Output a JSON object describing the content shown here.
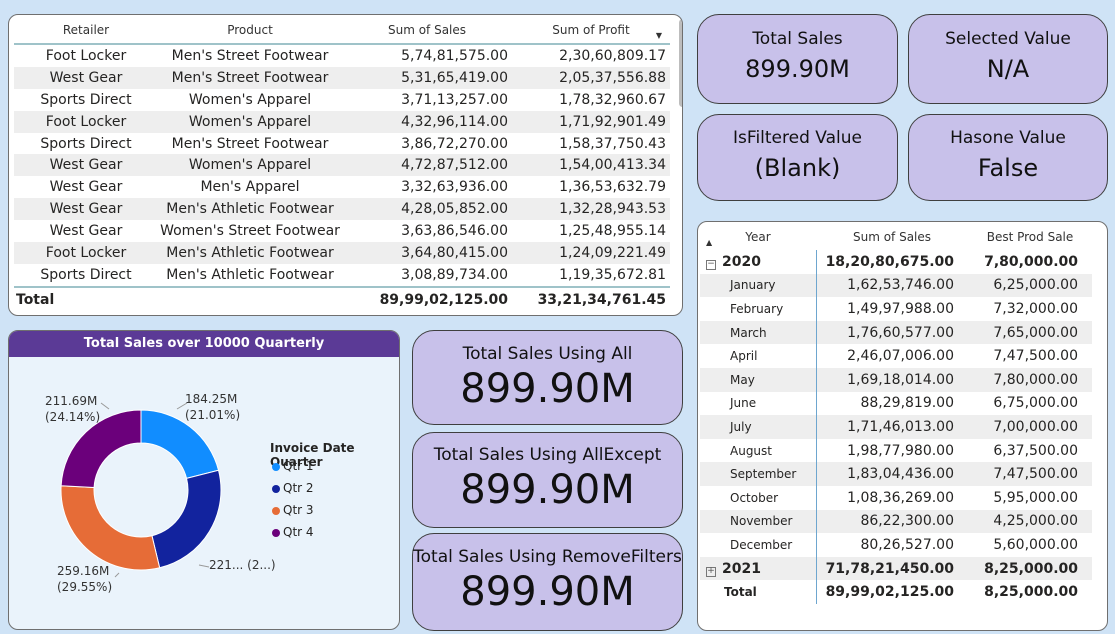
{
  "retail_table": {
    "columns": [
      "Retailer",
      "Product",
      "Sum of Sales",
      "Sum of Profit"
    ],
    "rows": [
      [
        "Foot Locker",
        "Men's Street Footwear",
        "5,74,81,575.00",
        "2,30,60,809.17"
      ],
      [
        "West Gear",
        "Men's Street Footwear",
        "5,31,65,419.00",
        "2,05,37,556.88"
      ],
      [
        "Sports Direct",
        "Women's Apparel",
        "3,71,13,257.00",
        "1,78,32,960.67"
      ],
      [
        "Foot Locker",
        "Women's Apparel",
        "4,32,96,114.00",
        "1,71,92,901.49"
      ],
      [
        "Sports Direct",
        "Men's Street Footwear",
        "3,86,72,270.00",
        "1,58,37,750.43"
      ],
      [
        "West Gear",
        "Women's Apparel",
        "4,72,87,512.00",
        "1,54,00,413.34"
      ],
      [
        "West Gear",
        "Men's Apparel",
        "3,32,63,936.00",
        "1,36,53,632.79"
      ],
      [
        "West Gear",
        "Men's Athletic Footwear",
        "4,28,05,852.00",
        "1,32,28,943.53"
      ],
      [
        "West Gear",
        "Women's Street Footwear",
        "3,63,86,546.00",
        "1,25,48,955.14"
      ],
      [
        "Foot Locker",
        "Men's Athletic Footwear",
        "3,64,80,415.00",
        "1,24,09,221.49"
      ],
      [
        "Sports Direct",
        "Men's Athletic Footwear",
        "3,08,89,734.00",
        "1,19,35,672.81"
      ]
    ],
    "total_label": "Total",
    "total_sales": "89,99,02,125.00",
    "total_profit": "33,21,34,761.45"
  },
  "cards": {
    "total_sales": {
      "title": "Total Sales",
      "value": "899.90M"
    },
    "selected_value": {
      "title": "Selected Value",
      "value": "N/A"
    },
    "isfiltered_value": {
      "title": "IsFiltered Value",
      "value": "(Blank)"
    },
    "hasone_value": {
      "title": "Hasone Value",
      "value": "False"
    },
    "using_all": {
      "title": "Total Sales Using All",
      "value": "899.90M"
    },
    "using_allexcept": {
      "title": "Total Sales Using AllExcept",
      "value": "899.90M"
    },
    "using_removefilters": {
      "title": "Total Sales Using RemoveFilters",
      "value": "899.90M"
    }
  },
  "chart_data": {
    "type": "pie",
    "title": "Total Sales over 10000 Quarterly",
    "legend_title": "Invoice Date Quarter",
    "legend_position": "right",
    "categories": [
      "Qtr 1",
      "Qtr 2",
      "Qtr 3",
      "Qtr 4"
    ],
    "values": [
      184.25,
      221.0,
      259.16,
      211.69
    ],
    "percents": [
      21.01,
      25.3,
      29.55,
      24.14
    ],
    "colors": [
      "#118DFF",
      "#12239E",
      "#E66C37",
      "#6B007B"
    ],
    "labels": {
      "qtr1": [
        "184.25M",
        "(21.01%)"
      ],
      "qtr2": [
        "221... (2...)"
      ],
      "qtr3": [
        "259.16M",
        "(29.55%)"
      ],
      "qtr4": [
        "211.69M",
        "(24.14%)"
      ]
    }
  },
  "year_table": {
    "columns": [
      "Year",
      "Sum of Sales",
      "Best Prod Sale"
    ],
    "year_2020": {
      "label": "2020",
      "sales": "18,20,80,675.00",
      "best": "7,80,000.00"
    },
    "months": [
      [
        "January",
        "1,62,53,746.00",
        "6,25,000.00"
      ],
      [
        "February",
        "1,49,97,988.00",
        "7,32,000.00"
      ],
      [
        "March",
        "1,76,60,577.00",
        "7,65,000.00"
      ],
      [
        "April",
        "2,46,07,006.00",
        "7,47,500.00"
      ],
      [
        "May",
        "1,69,18,014.00",
        "7,80,000.00"
      ],
      [
        "June",
        "88,29,819.00",
        "6,75,000.00"
      ],
      [
        "July",
        "1,71,46,013.00",
        "7,00,000.00"
      ],
      [
        "August",
        "1,98,77,980.00",
        "6,37,500.00"
      ],
      [
        "September",
        "1,83,04,436.00",
        "7,47,500.00"
      ],
      [
        "October",
        "1,08,36,269.00",
        "5,95,000.00"
      ],
      [
        "November",
        "86,22,300.00",
        "4,25,000.00"
      ],
      [
        "December",
        "80,26,527.00",
        "5,60,000.00"
      ]
    ],
    "year_2021": {
      "label": "2021",
      "sales": "71,78,21,450.00",
      "best": "8,25,000.00"
    },
    "total": {
      "label": "Total",
      "sales": "89,99,02,125.00",
      "best": "8,25,000.00"
    }
  }
}
